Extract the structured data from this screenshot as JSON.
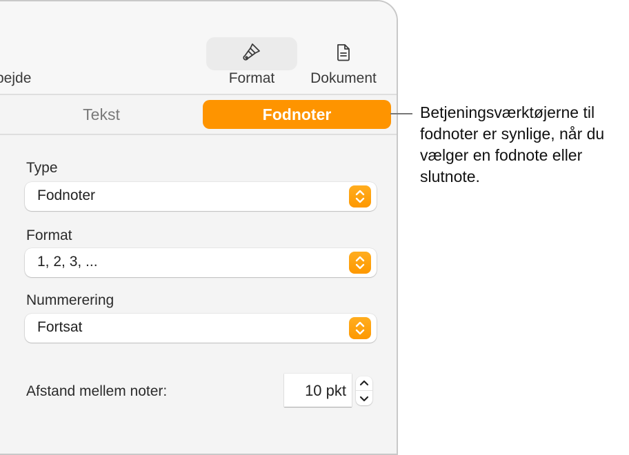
{
  "toolbar": {
    "left_label_partial": "bejde",
    "format_label": "Format",
    "document_label": "Dokument",
    "format_icon": "paintbrush-icon",
    "document_icon": "document-icon"
  },
  "tabs": [
    {
      "label": "Tekst",
      "active": false
    },
    {
      "label": "Fodnoter",
      "active": true
    }
  ],
  "fields": {
    "type": {
      "label": "Type",
      "value": "Fodnoter"
    },
    "format": {
      "label": "Format",
      "value": "1, 2, 3, ..."
    },
    "numbering": {
      "label": "Nummerering",
      "value": "Fortsat"
    },
    "spacing": {
      "label": "Afstand mellem noter:",
      "value": "10 pkt"
    }
  },
  "callout": {
    "text": "Betjeningsværktøjerne til fodnoter er synlige, når du vælger en fodnote eller slutnote."
  },
  "colors": {
    "accent": "#fe9400",
    "panel_bg": "#f4f4f4"
  }
}
